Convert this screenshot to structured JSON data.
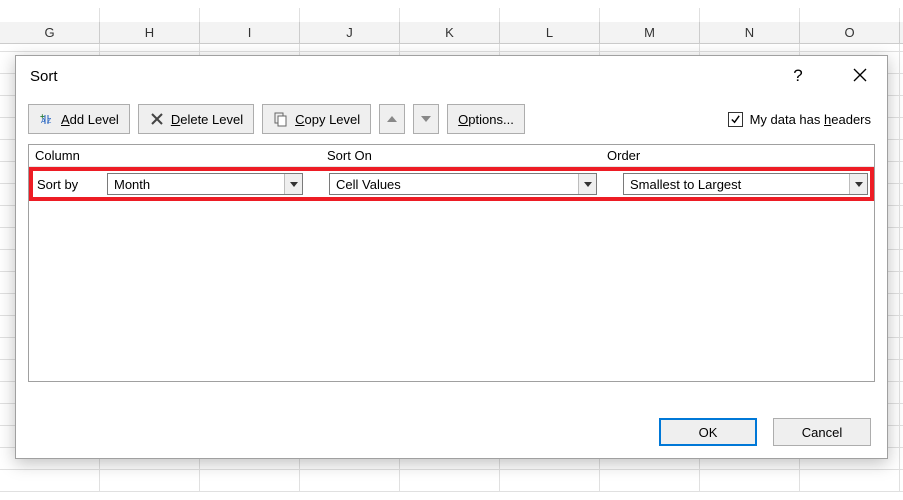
{
  "sheet": {
    "columns": [
      "G",
      "H",
      "I",
      "J",
      "K",
      "L",
      "M",
      "N",
      "O"
    ]
  },
  "dialog": {
    "title": "Sort",
    "toolbar": {
      "add_level": "Add Level",
      "delete_level": "Delete Level",
      "copy_level": "Copy Level",
      "options": "Options...",
      "headers_label_pre": "My data has ",
      "headers_label_key": "h",
      "headers_label_post": "eaders",
      "headers_checked": true
    },
    "grid": {
      "col1_header": "Column",
      "col2_header": "Sort On",
      "col3_header": "Order",
      "row": {
        "label": "Sort by",
        "column_value": "Month",
        "sorton_value": "Cell Values",
        "order_value": "Smallest to Largest"
      }
    },
    "footer": {
      "ok": "OK",
      "cancel": "Cancel"
    }
  }
}
